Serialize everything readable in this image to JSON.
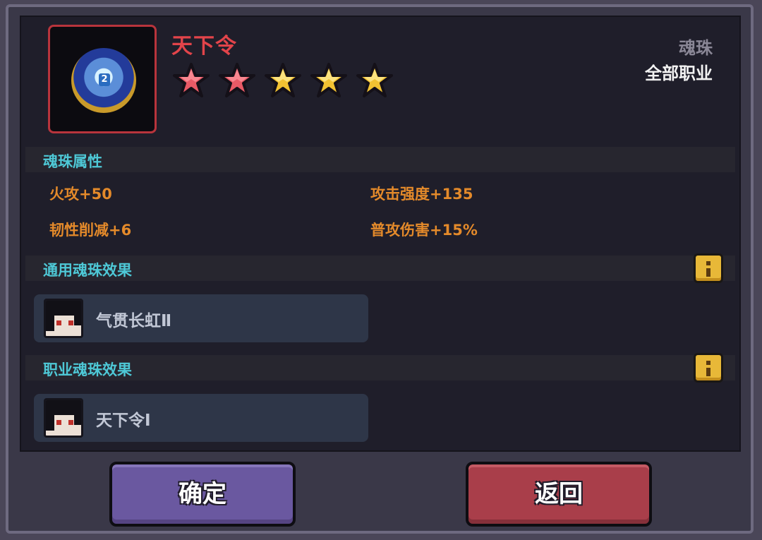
{
  "item": {
    "name": "天下令",
    "type": "魂珠",
    "class_restriction": "全部职业",
    "orb_digit": "2",
    "stars": [
      {
        "color": "red"
      },
      {
        "color": "red"
      },
      {
        "color": "gold"
      },
      {
        "color": "gold"
      },
      {
        "color": "gold"
      }
    ]
  },
  "attributes": {
    "header": "魂珠属性",
    "list": [
      "火攻+50",
      "攻击强度+135",
      "韧性削减+6",
      "普攻伤害+15%"
    ]
  },
  "general_effect": {
    "header": "通用魂珠效果",
    "name": "气贯长虹Ⅱ"
  },
  "class_effect": {
    "header": "职业魂珠效果",
    "name": "天下令Ⅰ"
  },
  "buttons": {
    "confirm": "确定",
    "back": "返回"
  },
  "colors": {
    "title": "#e2444a",
    "section_header": "#4ec8d6",
    "attribute": "#e48a2a",
    "confirm_button": "#6a58a0",
    "back_button": "#a93e4a"
  }
}
